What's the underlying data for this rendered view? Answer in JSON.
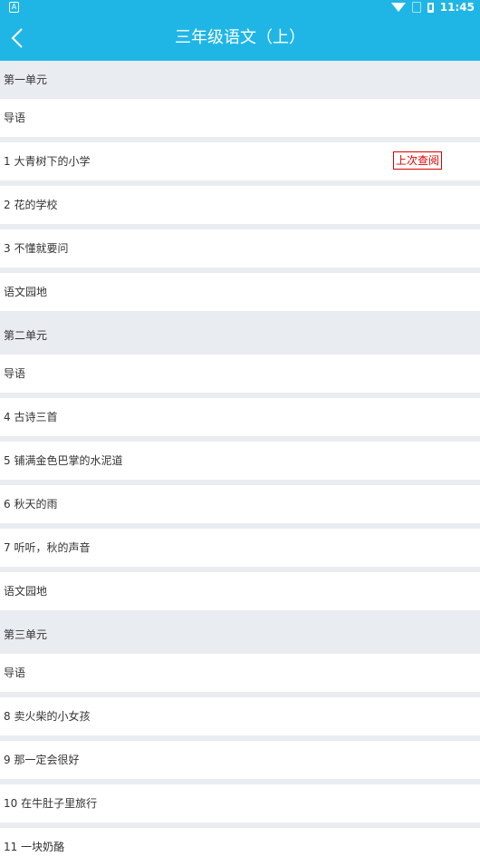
{
  "status_bar": {
    "time": "11:45"
  },
  "header": {
    "title": "三年级语文（上）"
  },
  "list": [
    {
      "type": "section",
      "label": "第一单元"
    },
    {
      "type": "item",
      "label": "导语"
    },
    {
      "type": "item",
      "label": "1 大青树下的小学",
      "badge": "上次查阅"
    },
    {
      "type": "item",
      "label": "2 花的学校"
    },
    {
      "type": "item",
      "label": "3 不懂就要问"
    },
    {
      "type": "item",
      "label": "语文园地"
    },
    {
      "type": "section",
      "label": "第二单元"
    },
    {
      "type": "item",
      "label": "导语"
    },
    {
      "type": "item",
      "label": "4 古诗三首"
    },
    {
      "type": "item",
      "label": "5 铺满金色巴掌的水泥道"
    },
    {
      "type": "item",
      "label": "6 秋天的雨"
    },
    {
      "type": "item",
      "label": "7 听听，秋的声音"
    },
    {
      "type": "item",
      "label": "语文园地"
    },
    {
      "type": "section",
      "label": "第三单元"
    },
    {
      "type": "item",
      "label": "导语"
    },
    {
      "type": "item",
      "label": "8 卖火柴的小女孩"
    },
    {
      "type": "item",
      "label": "9 那一定会很好"
    },
    {
      "type": "item",
      "label": "10 在牛肚子里旅行"
    },
    {
      "type": "item",
      "label": "11 一块奶酪"
    }
  ]
}
